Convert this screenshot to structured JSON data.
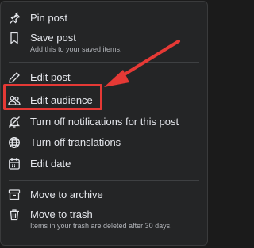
{
  "menu": {
    "items": [
      {
        "label": "Pin post",
        "icon": "pin-icon"
      },
      {
        "label": "Save post",
        "sub": "Add this to your saved items.",
        "icon": "bookmark-icon"
      },
      {
        "label": "Edit post",
        "icon": "pencil-icon"
      },
      {
        "label": "Edit audience",
        "icon": "people-icon"
      },
      {
        "label": "Turn off notifications for this post",
        "icon": "bell-off-icon"
      },
      {
        "label": "Turn off translations",
        "icon": "globe-icon"
      },
      {
        "label": "Edit date",
        "icon": "calendar-icon"
      },
      {
        "label": "Move to archive",
        "icon": "archive-icon"
      },
      {
        "label": "Move to trash",
        "sub": "Items in your trash are deleted after 30 days.",
        "icon": "trash-icon"
      }
    ]
  },
  "annotation": {
    "highlight_color": "#e53935"
  }
}
